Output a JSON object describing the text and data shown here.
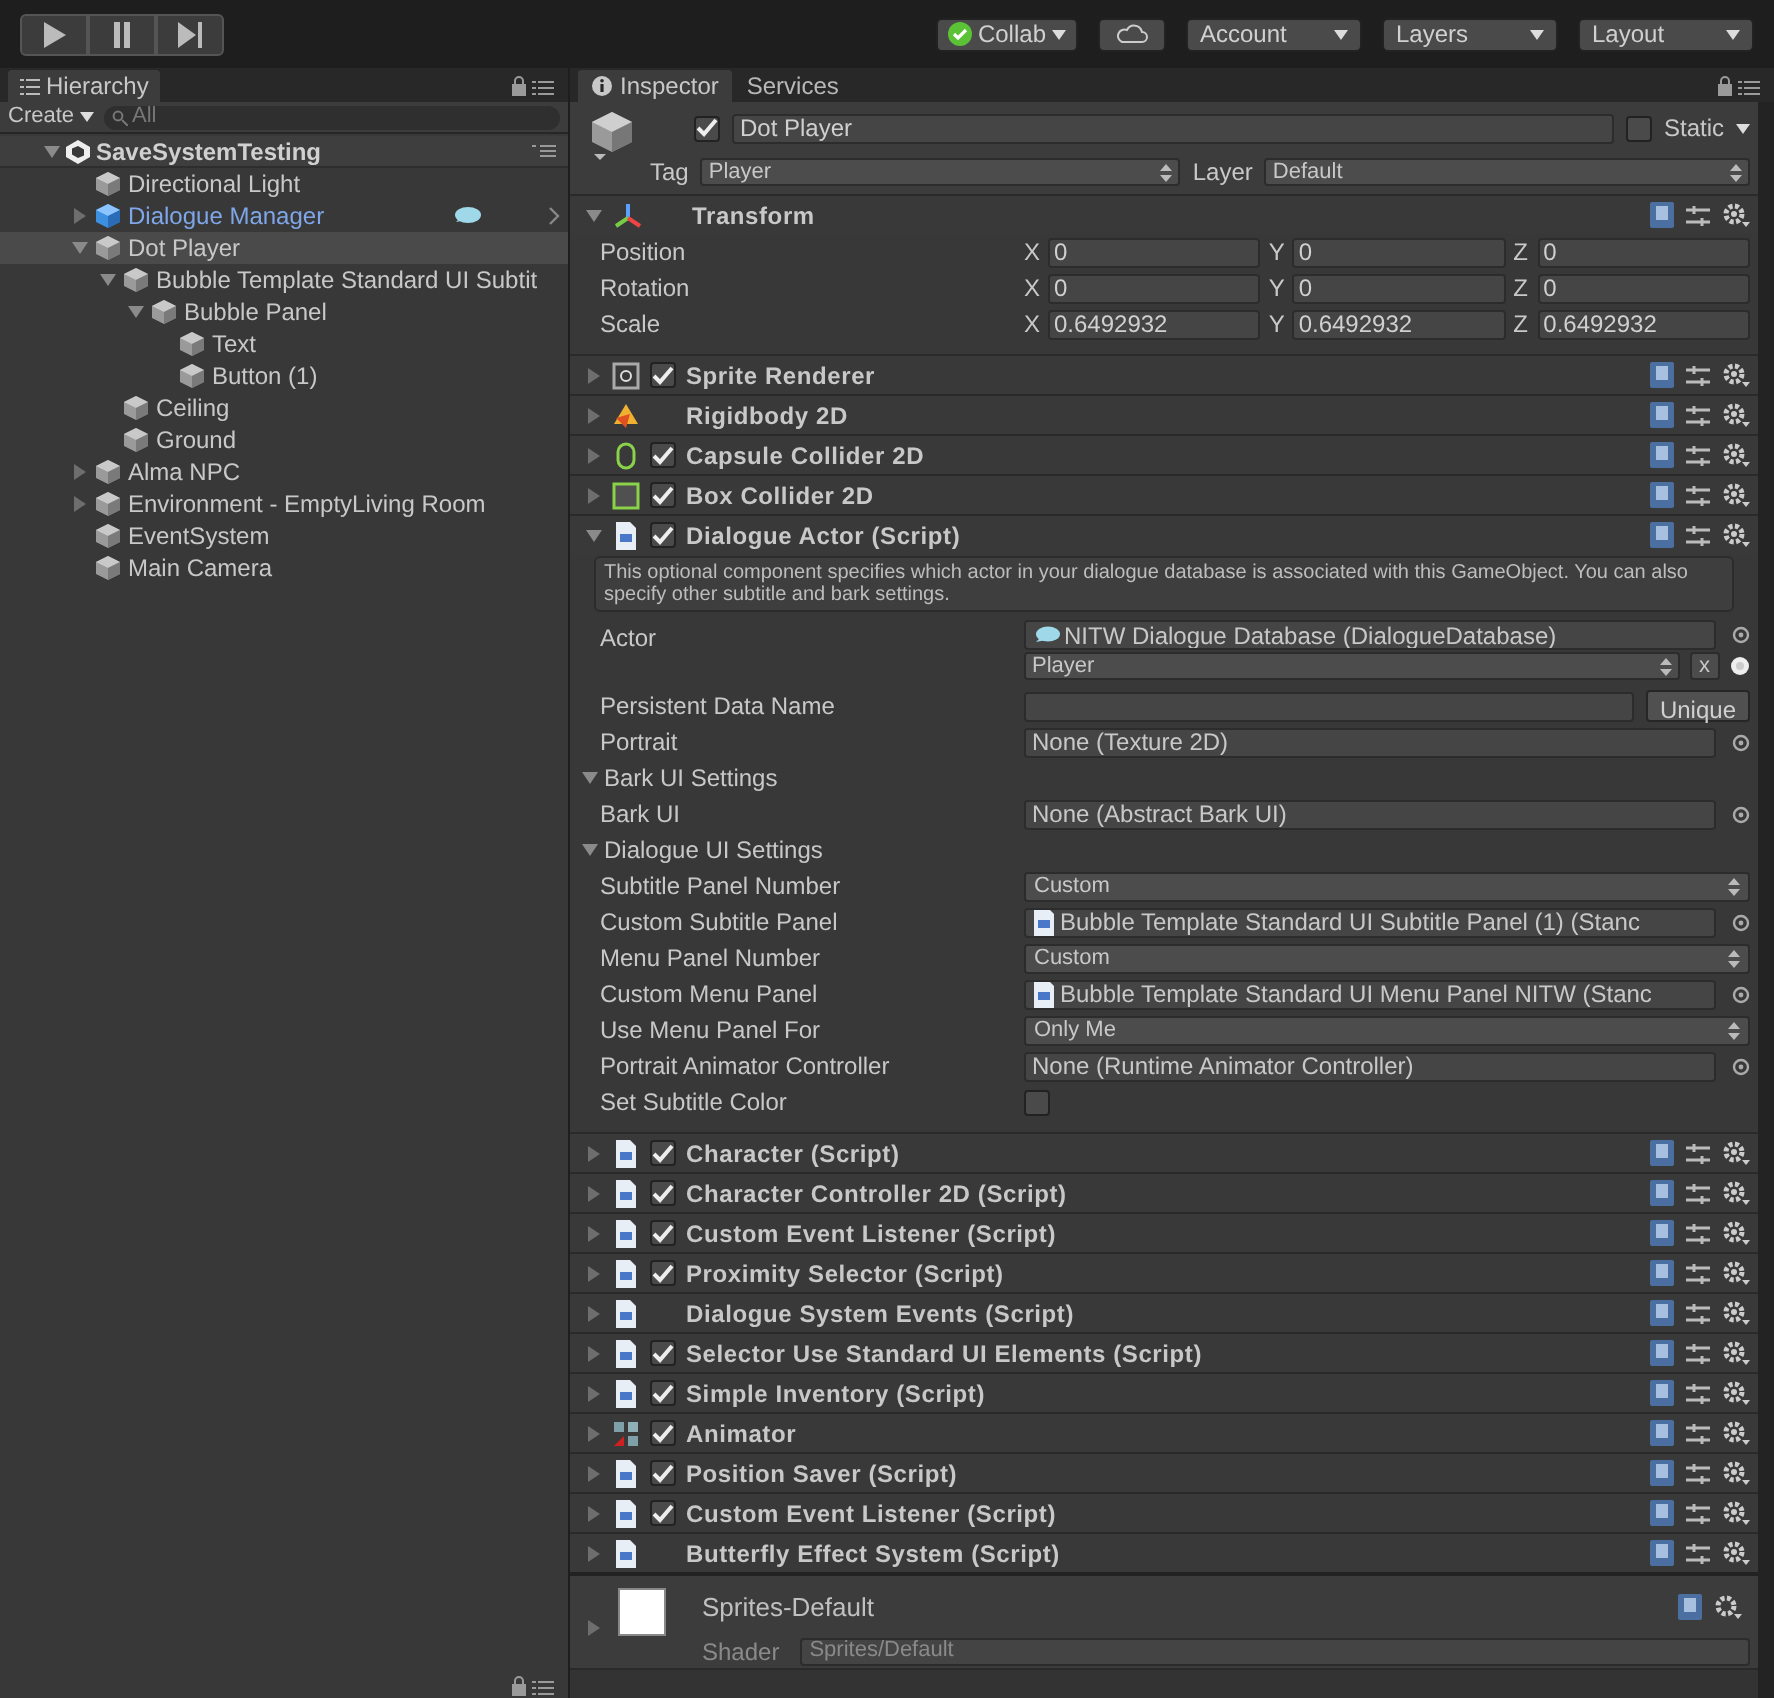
{
  "toolbar": {
    "play_controls": [
      {
        "kind": "play",
        "on": false
      },
      {
        "kind": "pause",
        "on": false
      },
      {
        "kind": "step",
        "on": false
      }
    ],
    "collab": "Collab",
    "menus": [
      "Account",
      "Layers",
      "Layout"
    ]
  },
  "hierarchy": {
    "tab": "Hierarchy",
    "create": "Create",
    "search_placeholder": "All",
    "scene": {
      "name": "SaveSystemTesting",
      "children": [
        {
          "name": "Directional Light",
          "kind": "leaf",
          "prefab": false,
          "selected": false
        },
        {
          "name": "Dialogue Manager",
          "kind": "group",
          "expanded": false,
          "prefab": true,
          "selected": false
        },
        {
          "name": "Dot Player",
          "kind": "group",
          "expanded": true,
          "prefab": false,
          "selected": true,
          "children": [
            {
              "name": "Bubble Template Standard UI Subtit",
              "kind": "group",
              "expanded": true,
              "prefab": false,
              "selected": false,
              "children": [
                {
                  "name": "Bubble Panel",
                  "kind": "group",
                  "expanded": true,
                  "prefab": false,
                  "selected": false,
                  "children": [
                    {
                      "name": "Text",
                      "kind": "leaf",
                      "prefab": false,
                      "selected": false
                    },
                    {
                      "name": "Button (1)",
                      "kind": "leaf",
                      "prefab": false,
                      "selected": false
                    }
                  ]
                }
              ]
            },
            {
              "name": "Ceiling",
              "kind": "leaf",
              "prefab": false,
              "selected": false
            },
            {
              "name": "Ground",
              "kind": "leaf",
              "prefab": false,
              "selected": false
            }
          ]
        },
        {
          "name": "Alma NPC",
          "kind": "group",
          "expanded": false,
          "prefab": false,
          "selected": false
        },
        {
          "name": "Environment -  EmptyLiving Room",
          "kind": "group",
          "expanded": false,
          "prefab": false,
          "selected": false
        },
        {
          "name": "EventSystem",
          "kind": "leaf",
          "prefab": false,
          "selected": false
        },
        {
          "name": "Main Camera",
          "kind": "leaf",
          "prefab": false,
          "selected": false
        }
      ]
    }
  },
  "tabs": [
    {
      "label": "Inspector",
      "selected": true
    },
    {
      "label": "Services",
      "selected": false
    }
  ],
  "object": {
    "name": "Dot Player",
    "active": true,
    "static_label": "Static",
    "static": false,
    "tag_label": "Tag",
    "tag": "Player",
    "layer_label": "Layer",
    "layer": "Default"
  },
  "transform": {
    "title": "Transform",
    "rows": [
      {
        "label": "Position",
        "values": [
          {
            "axis": "X",
            "value": "0"
          },
          {
            "axis": "Y",
            "value": "0"
          },
          {
            "axis": "Z",
            "value": "0"
          }
        ]
      },
      {
        "label": "Rotation",
        "values": [
          {
            "axis": "X",
            "value": "0"
          },
          {
            "axis": "Y",
            "value": "0"
          },
          {
            "axis": "Z",
            "value": "0"
          }
        ]
      },
      {
        "label": "Scale",
        "values": [
          {
            "axis": "X",
            "value": "0.6492932"
          },
          {
            "axis": "Y",
            "value": "0.6492932"
          },
          {
            "axis": "Z",
            "value": "0.6492932"
          }
        ]
      }
    ]
  },
  "components": [
    {
      "title": "Sprite Renderer",
      "kind": "sprite",
      "checked": true,
      "expanded": false
    },
    {
      "title": "Rigidbody 2D",
      "kind": "rigidbody",
      "expanded": false
    },
    {
      "title": "Capsule Collider 2D",
      "kind": "capsule",
      "checked": true,
      "expanded": false
    },
    {
      "title": "Box Collider 2D",
      "kind": "box",
      "checked": true,
      "expanded": false
    },
    {
      "title": "Dialogue Actor (Script)",
      "kind": "script",
      "checked": true,
      "expanded": true,
      "help": "This optional component specifies which actor in your dialogue database is associated with this GameObject. You can also specify other subtitle and bark settings.",
      "fields": [
        {
          "kind": "actor",
          "label": "Actor",
          "value": "NITW Dialogue Database (DialogueDatabase)",
          "popup": "Player",
          "clear": "x"
        },
        {
          "kind": "text-button",
          "label": "Persistent Data Name",
          "button": "Unique"
        },
        {
          "kind": "object",
          "label": "Portrait",
          "value": "None (Texture 2D)"
        },
        {
          "kind": "section",
          "label": "Bark UI Settings",
          "expanded": true
        },
        {
          "kind": "object",
          "label": "Bark UI",
          "value": "None (Abstract Bark UI)"
        },
        {
          "kind": "section",
          "label": "Dialogue UI Settings",
          "expanded": true
        },
        {
          "kind": "popup",
          "label": "Subtitle Panel Number",
          "value": "Custom"
        },
        {
          "kind": "script-object",
          "label": "Custom Subtitle Panel",
          "value": "Bubble Template Standard UI Subtitle Panel (1) (Stanc"
        },
        {
          "kind": "popup",
          "label": "Menu Panel Number",
          "value": "Custom"
        },
        {
          "kind": "script-object",
          "label": "Custom Menu Panel",
          "value": "Bubble Template Standard UI Menu Panel NITW (Stanc"
        },
        {
          "kind": "popup",
          "label": "Use Menu Panel For",
          "value": "Only Me"
        },
        {
          "kind": "object",
          "label": "Portrait Animator Controller",
          "value": "None (Runtime Animator Controller)"
        },
        {
          "kind": "checkbox",
          "label": "Set Subtitle Color",
          "checked": false
        }
      ]
    },
    {
      "title": "Character (Script)",
      "kind": "script",
      "checked": true,
      "expanded": false
    },
    {
      "title": "Character Controller 2D (Script)",
      "kind": "script",
      "checked": true,
      "expanded": false
    },
    {
      "title": "Custom Event Listener (Script)",
      "kind": "script",
      "checked": true,
      "expanded": false
    },
    {
      "title": "Proximity Selector (Script)",
      "kind": "script",
      "checked": true,
      "expanded": false
    },
    {
      "title": "Dialogue System Events (Script)",
      "kind": "script",
      "expanded": false
    },
    {
      "title": "Selector Use Standard UI Elements (Script)",
      "kind": "script",
      "checked": true,
      "expanded": false
    },
    {
      "title": "Simple Inventory (Script)",
      "kind": "script",
      "checked": true,
      "expanded": false
    },
    {
      "title": "Animator",
      "kind": "animator",
      "checked": true,
      "expanded": false
    },
    {
      "title": "Position Saver (Script)",
      "kind": "script",
      "checked": true,
      "expanded": false
    },
    {
      "title": "Custom Event Listener (Script)",
      "kind": "script",
      "checked": true,
      "expanded": false
    },
    {
      "title": "Butterfly Effect System (Script)",
      "kind": "script",
      "expanded": false
    }
  ],
  "material": {
    "name": "Sprites-Default",
    "shader_label": "Shader",
    "shader": "Sprites/Default",
    "disabled": true
  }
}
